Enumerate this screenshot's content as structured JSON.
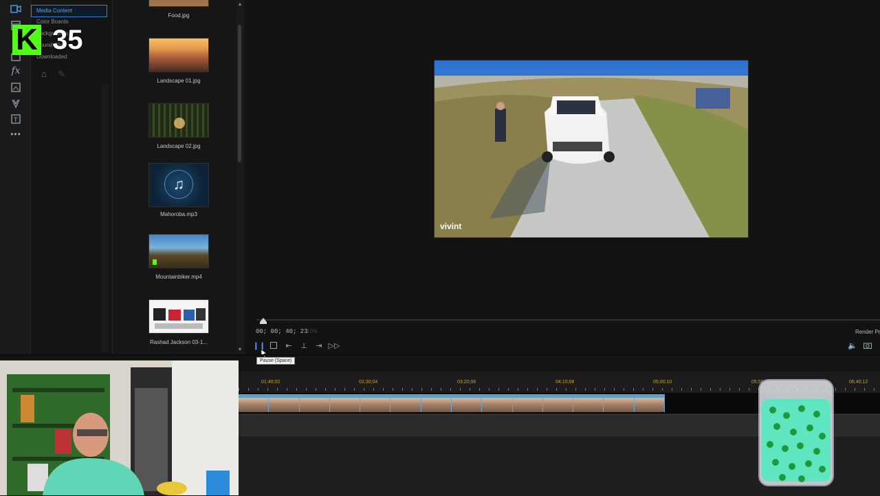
{
  "library_menu": {
    "items": [
      "Media Content",
      "Color Boards",
      "Backgrounds",
      "Sound Clips",
      "Downloaded"
    ],
    "selected": "Media Content"
  },
  "overlay_logo": {
    "letter": "K",
    "number": "35"
  },
  "media_library": {
    "items": [
      {
        "label": "Food.jpg",
        "kind": "image"
      },
      {
        "label": "Landscape 01.jpg",
        "kind": "image"
      },
      {
        "label": "Landscape 02.jpg",
        "kind": "image"
      },
      {
        "label": "Mahoroba.mp3",
        "kind": "audio"
      },
      {
        "label": "Mountainbiker.mp4",
        "kind": "video"
      },
      {
        "label": "Rashad Jackson 03-1...",
        "kind": "image"
      }
    ]
  },
  "preview": {
    "watermark": "vivint",
    "timecode": "00; 00; 40; 23",
    "timecode_secondary": "10%",
    "render_label": "Render Pr",
    "tooltip": "Pause (Space)"
  },
  "timeline": {
    "ruler_labels": [
      "01;40;02",
      "02;30;04",
      "03;20;06",
      "04;10;08",
      "05;00;10",
      "05;50",
      "06;40;12"
    ]
  },
  "colors": {
    "accent_blue": "#4aa3ff",
    "kick_green": "#53fc18",
    "ruler_gold": "#c9a33a"
  }
}
